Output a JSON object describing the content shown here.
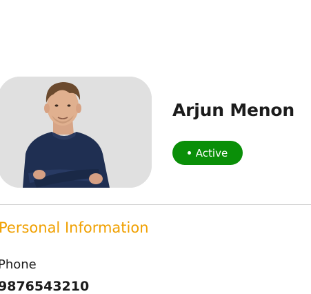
{
  "profile": {
    "name": "Arjun Menon",
    "status": "Active",
    "status_color": "#0a8f08",
    "avatar": "person-photo"
  },
  "section": {
    "title": "Personal Information",
    "title_color": "#f0a000"
  },
  "fields": [
    {
      "label": "Phone",
      "value": "9876543210"
    }
  ]
}
